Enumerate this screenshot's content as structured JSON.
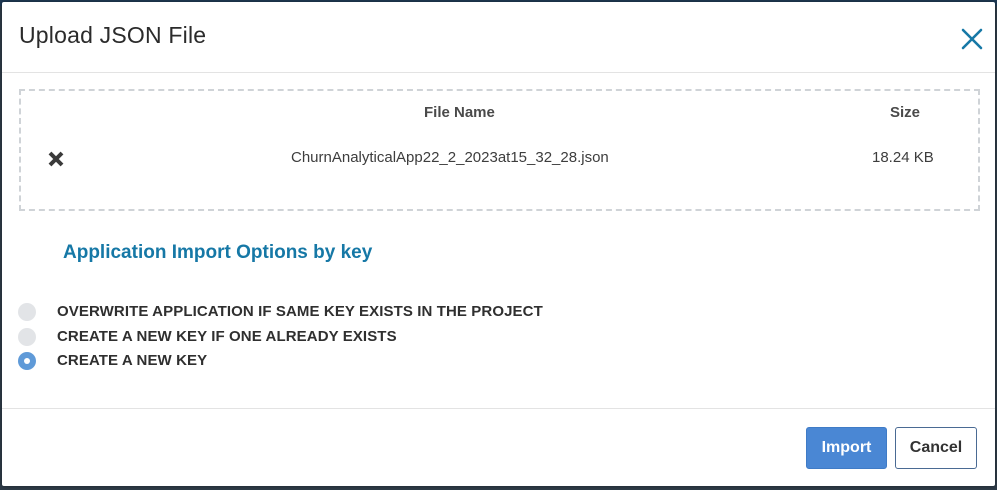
{
  "dialog": {
    "title": "Upload JSON File"
  },
  "file_table": {
    "headers": {
      "name": "File Name",
      "size": "Size"
    },
    "rows": [
      {
        "name": "ChurnAnalyticalApp22_2_2023at15_32_28.json",
        "size": "18.24 KB"
      }
    ]
  },
  "options": {
    "title": "Application Import Options by key",
    "items": [
      {
        "label": "OVERWRITE APPLICATION IF SAME KEY EXISTS IN THE PROJECT",
        "selected": false
      },
      {
        "label": "CREATE A NEW KEY IF ONE ALREADY EXISTS",
        "selected": false
      },
      {
        "label": "CREATE A NEW KEY",
        "selected": true
      }
    ]
  },
  "footer": {
    "import_label": "Import",
    "cancel_label": "Cancel"
  },
  "colors": {
    "accent": "#1678a6",
    "primary_button": "#4a87d4",
    "radio_checked": "#5f9ad8"
  },
  "icons": {
    "close": "close-icon",
    "remove": "remove-file-icon"
  }
}
